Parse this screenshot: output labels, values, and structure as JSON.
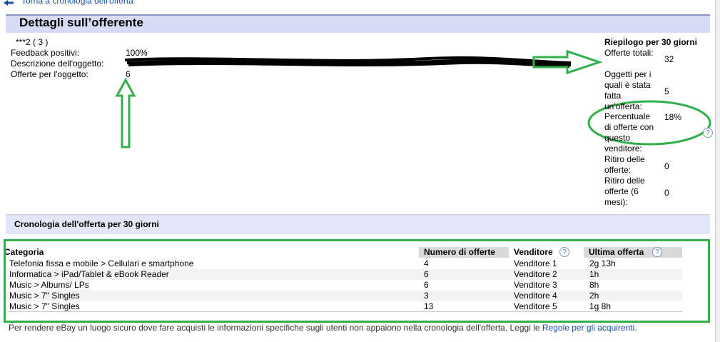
{
  "nav": {
    "back_link": "Torna a cronologia dell'offerta"
  },
  "header": {
    "title": "Dettagli sull’offerente"
  },
  "bidder": {
    "id_line": "***2 ( 3 )",
    "feedback_label": "Feedback positivi:",
    "feedback_value": "100%",
    "description_label": "Descrizione dell'oggetto:",
    "bids_label": "Offerte per l'oggetto:",
    "bids_value": "6"
  },
  "summary": {
    "title": "Riepilogo per 30 giorni",
    "items": [
      {
        "label": "Offerte totali:",
        "value": "32"
      },
      {
        "label": "Oggetti per i quali è stata fatta un'offerta:",
        "value": "5"
      },
      {
        "label": "Percentuale di offerte con questo venditore:",
        "value": "18%"
      },
      {
        "label": "Ritiro delle offerte:",
        "value": "0"
      },
      {
        "label": "Ritiro delle offerte (6 mesi):",
        "value": "0"
      }
    ]
  },
  "history": {
    "title": "Cronologia dell'offerta per 30 giorni",
    "headers": {
      "category": "Categoria",
      "bids": "Numero di offerte",
      "seller": "Venditore",
      "last": "Ultima offerta"
    },
    "rows": [
      {
        "category": "Telefonia fissa e mobile > Cellulari e smartphone",
        "bids": "4",
        "seller": "Venditore 1",
        "last": "2g 13h"
      },
      {
        "category": "Informatica > iPad/Tablet & eBook Reader",
        "bids": "6",
        "seller": "Venditore 2",
        "last": "1h"
      },
      {
        "category": "Music > Albums/ LPs",
        "bids": "6",
        "seller": "Venditore 3",
        "last": "8h"
      },
      {
        "category": "Music > 7\" Singles",
        "bids": "3",
        "seller": "Venditore 4",
        "last": "2h"
      },
      {
        "category": "Music > 7\" Singles",
        "bids": "13",
        "seller": "Venditore 5",
        "last": "1g 8h"
      }
    ]
  },
  "footer": {
    "text": "Per rendere eBay un luogo sicuro dove fare acquisti le informazioni specifiche sugli utenti non appaiono nella cronologia dell'offerta. Leggi le ",
    "link": "Regole per gli acquirenti."
  },
  "colors": {
    "annotation_green": "#2fb04a",
    "header_bg": "#d7dbf5",
    "link": "#1a4ea8"
  }
}
